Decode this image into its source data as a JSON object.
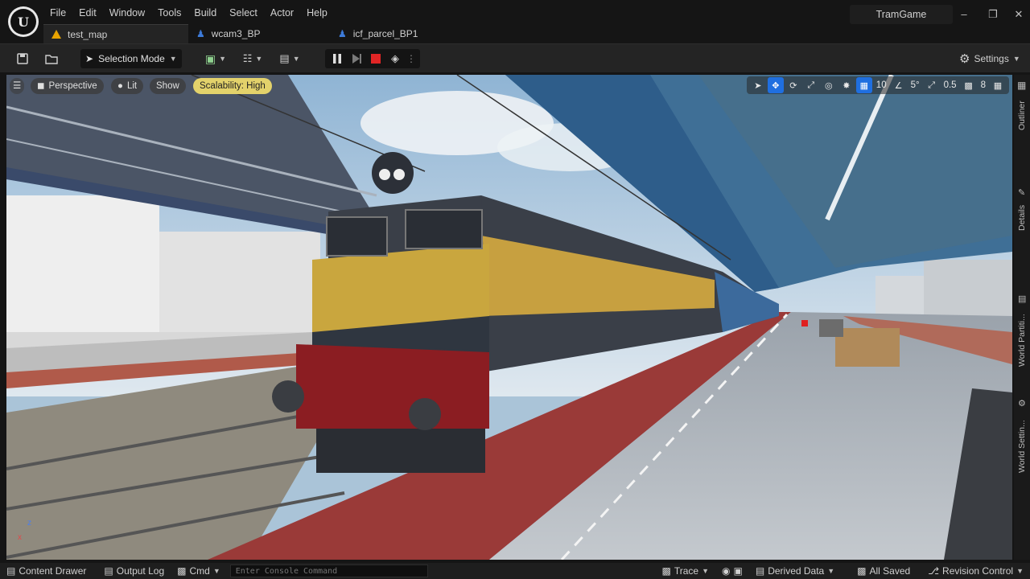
{
  "menu": [
    "File",
    "Edit",
    "Window",
    "Tools",
    "Build",
    "Select",
    "Actor",
    "Help"
  ],
  "project_name": "TramGame",
  "tabs": [
    {
      "label": "test_map",
      "icon": "warning-icon",
      "active": true
    },
    {
      "label": "wcam3_BP",
      "icon": "blueprint-icon",
      "active": false
    },
    {
      "label": "icf_parcel_BP1",
      "icon": "blueprint-icon",
      "active": false
    }
  ],
  "toolbar": {
    "selection_mode": "Selection Mode",
    "settings": "Settings"
  },
  "viewport": {
    "perspective": "Perspective",
    "lit": "Lit",
    "show": "Show",
    "scalability": "Scalability: High",
    "grid_snap": "10",
    "rotation_snap": "5°",
    "scale_snap": "0.5",
    "camera_speed": "8",
    "axis_z": "z",
    "axis_x": "x"
  },
  "side_tabs": [
    "Outliner",
    "Details",
    "World Partiti...",
    "World Settin..."
  ],
  "status": {
    "content_drawer": "Content Drawer",
    "output_log": "Output Log",
    "cmd": "Cmd",
    "console_placeholder": "Enter Console Command",
    "trace": "Trace",
    "derived_data": "Derived Data",
    "all_saved": "All Saved",
    "revision_control": "Revision Control"
  },
  "colors": {
    "accent": "#1f6fe0",
    "scalability": "#e3d26b",
    "stop": "#e02525"
  }
}
